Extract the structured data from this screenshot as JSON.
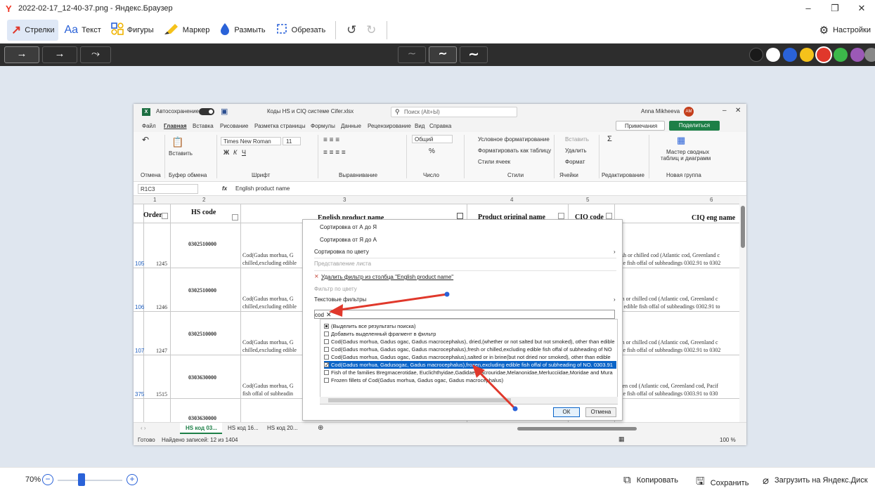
{
  "window": {
    "title": "2022-02-17_12-40-37.png - Яндекс.Браузер",
    "controls": [
      "–",
      "❐",
      "✕"
    ]
  },
  "toolbar": {
    "tools": [
      {
        "label": "Стрелки",
        "icon": "arrow-icon",
        "glyph": "↗",
        "color": "#e0382b"
      },
      {
        "label": "Текст",
        "icon": "text-icon",
        "glyph": "Aa",
        "color": "#2a62d8"
      },
      {
        "label": "Фигуры",
        "icon": "shapes-icon",
        "glyph": "▢",
        "color": "#f0b400"
      },
      {
        "label": "Маркер",
        "icon": "marker-icon",
        "glyph": "✎",
        "color": "#f0b400"
      },
      {
        "label": "Размыть",
        "icon": "blur-drop-icon",
        "glyph": "●",
        "color": "#2a62d8"
      },
      {
        "label": "Обрезать",
        "icon": "crop-icon",
        "glyph": "⬚",
        "color": "#2a62d8"
      }
    ],
    "settings_label": "Настройки"
  },
  "options": {
    "arrow_styles": [
      "→",
      "→",
      "⤳"
    ],
    "line_styles": [
      "∼",
      "∼",
      "∼"
    ],
    "colors": [
      "#1a1a1a",
      "#ffffff",
      "#2a62d8",
      "#f5c21b",
      "#e0382b",
      "#3cb84a",
      "#9b59b6",
      "#888888"
    ],
    "selected_color_index": 4
  },
  "excel": {
    "title_autosave": "Автосохранение",
    "filename": "Коды HS и CIQ системе Cifer.xlsx",
    "search_placeholder": "Поиск (Alt+Ы)",
    "user": "Anna Mikheeva",
    "user_initials": "AM",
    "tabs": [
      "Файл",
      "Главная",
      "Вставка",
      "Рисование",
      "Разметка страницы",
      "Формулы",
      "Данные",
      "Рецензирование",
      "Вид",
      "Справка"
    ],
    "comments_label": "Примечания",
    "share_label": "Поделиться",
    "ribbon": {
      "undo_group": "Отмена",
      "paste": "Вставить",
      "clipboard": "Буфер обмена",
      "font_name": "Times New Roman",
      "font_size": "11",
      "font_group": "Шрифт",
      "align_group": "Выравнивание",
      "number_format": "Общий",
      "number_group": "Число",
      "cond_format": "Условное форматирование",
      "format_table": "Форматировать как таблицу",
      "cell_styles": "Стили ячеек",
      "styles_group": "Стили",
      "insert": "Вставить",
      "delete": "Удалить",
      "format": "Формат",
      "cells_group": "Ячейки",
      "edit_group": "Редактирование",
      "pivot_wizard_1": "Мастер сводных",
      "pivot_wizard_2": "таблиц и диаграмм",
      "new_group": "Новая группа"
    },
    "name_box": "R1C3",
    "formula": "English product name",
    "col_numbers": [
      "1",
      "2",
      "3",
      "4",
      "5",
      "6"
    ],
    "headers": [
      "Order",
      "HS code",
      "English product name",
      "Product original name",
      "CIQ code",
      "CIQ eng name"
    ],
    "rows": [
      {
        "rownum": "105",
        "order": "1245",
        "hs": "0302510000",
        "eng1": "Cod(Gadus morhua, G",
        "eng2": "chilled,excluding edible",
        "ciq1": "> esh or chilled cod (Atlantic cod, Greenland c",
        "ciq2": "ible fish offal of subheadings 0302.91 to 0302"
      },
      {
        "rownum": "106",
        "order": "1246",
        "hs": "0302510000",
        "eng1": "Cod(Gadus morhua, G",
        "eng2": "chilled,excluding edible",
        "ciq1": "esh or chilled cod (Atlantic cod, Greenland c",
        "ciq2": "an edible fish offal of subheadings 0302.91 to"
      },
      {
        "rownum": "107",
        "order": "1247",
        "hs": "0302510000",
        "eng1": "Cod(Gadus morhua, G",
        "eng2": "chilled,excluding edible",
        "ciq1": "esh or chilled cod (Atlantic cod, Greenland c",
        "ciq2": "ible fish offal of subheadings 0302.91 to 0302"
      },
      {
        "rownum": "375",
        "order": "1515",
        "hs": "0303630000",
        "eng1": "Cod(Gadus morhua, G",
        "eng2": "fish offal of subheadin",
        "ciq1": "ozen cod (Atlantic cod, Greenland cod, Pacif",
        "ciq2": "ible fish offal of subheadings 0303.91 to 030"
      },
      {
        "rownum": "",
        "order": "",
        "hs": "0303630000",
        "eng1": "",
        "eng2": "",
        "ciq1": "",
        "ciq2": ""
      }
    ],
    "sheet_tabs": [
      "HS код 03...",
      "HS код 16...",
      "HS код 20..."
    ],
    "status_ready": "Готово",
    "status_found": "Найдено записей: 12 из 1404",
    "zoom": "100 %"
  },
  "filter_menu": {
    "sort_az": "Сортировка от А до Я",
    "sort_za": "Сортировка от Я до А",
    "sort_color": "Сортировка по цвету",
    "sheet_view": "Представление листа",
    "clear_filter": "Удалить фильтр из столбца \"English product name\"",
    "filter_color": "Фильтр по цвету",
    "text_filters": "Текстовые фильтры",
    "search_value": "cod",
    "list": [
      {
        "text": "(Выделить все результаты поиска)",
        "state": "partial"
      },
      {
        "text": "Добавить выделенный фрагмент в фильтр",
        "state": "off"
      },
      {
        "text": "Cod(Gadus morhua, Gadus ogac, Gadus macrocephalus), dried,(whether or not salted but not smoked), other than edible",
        "state": "off"
      },
      {
        "text": "Cod(Gadus morhua, Gadus ogac, Gadus macrocephalus),fresh or chilled,excluding edible fish offal of subheading of NO",
        "state": "off"
      },
      {
        "text": "Cod(Gadus morhua, Gadus ogac, Gadus macrocephalus),salted or in brine(but not dried nor smoked), other than edible",
        "state": "off"
      },
      {
        "text": "Cod(Gadus morhua, Gadusogac, Gadus macrocephalus),frozen,excluding edible fish offal of subheading of NO. 0303.91",
        "state": "checked",
        "selected": true
      },
      {
        "text": "Fish of the families Bregmacerotidae, Euclichthyidae,Gadidae,Macrouridae,Melanonidae,Merlucciidae,Moridae and Mura",
        "state": "off"
      },
      {
        "text": "Frozen fillets of Cod(Gadus morhua, Gadus ogac, Gadus macrocephalus)",
        "state": "off"
      }
    ],
    "ok": "ОК",
    "cancel": "Отмена"
  },
  "bottombar": {
    "zoom": "70%",
    "copy": "Копировать",
    "save": "Сохранить",
    "upload": "Загрузить на Яндекс.Диск"
  }
}
